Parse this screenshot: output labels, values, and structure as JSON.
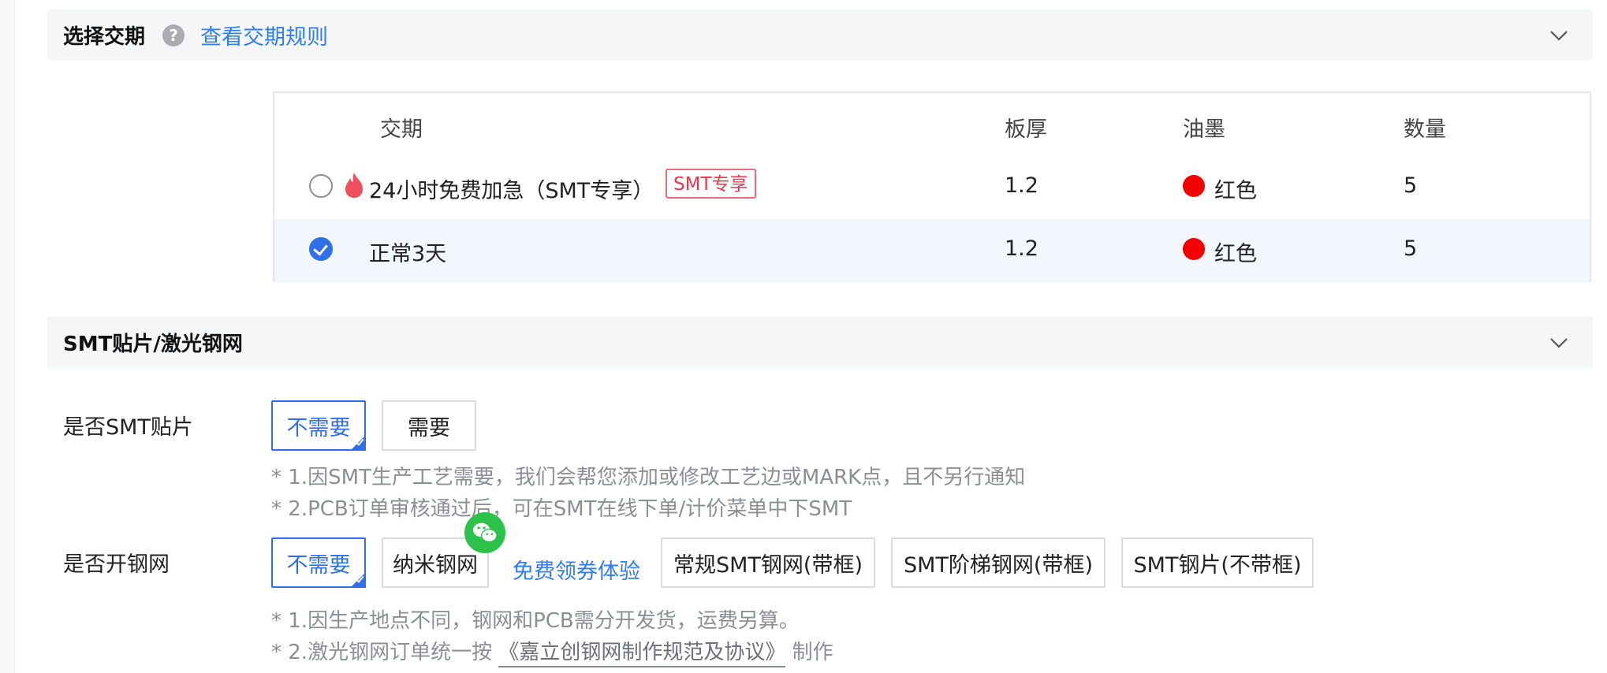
{
  "lead_time_section": {
    "title": "选择交期",
    "help_icon": "question-icon",
    "rules_link": "查看交期规则",
    "table": {
      "headers": [
        "交期",
        "板厚",
        "油墨",
        "数量"
      ],
      "rows": [
        {
          "label": "24小时免费加急（SMT专享）",
          "badge": "SMT专享",
          "thickness": "1.2",
          "ink_color": "#f50000",
          "ink": "红色",
          "quantity": "5",
          "checked": false,
          "icon": "flame-icon"
        },
        {
          "label": "正常3天",
          "thickness": "1.2",
          "ink_color": "#f50000",
          "ink": "红色",
          "quantity": "5",
          "checked": true
        }
      ]
    }
  },
  "smt_section": {
    "title": "SMT贴片/激光钢网",
    "smt_assembly": {
      "label": "是否SMT贴片",
      "options": [
        "不需要",
        "需要"
      ],
      "selected": "不需要",
      "notes": [
        "* 1.因SMT生产工艺需要，我们会帮您添加或修改工艺边或MARK点，且不另行通知",
        "* 2.PCB订单审核通过后，可在SMT在线下单/计价菜单中下SMT"
      ]
    },
    "stencil": {
      "label": "是否开钢网",
      "options": [
        "不需要",
        "纳米钢网",
        "常规SMT钢网(带框)",
        "SMT阶梯钢网(带框)",
        "SMT钢片(不带框)"
      ],
      "selected": "不需要",
      "promo_link": "免费领券体验",
      "promo_icon": "wechat-icon",
      "note1": "* 1.因生产地点不同，钢网和PCB需分开发货，运费另算。",
      "note2_prefix": "* 2.激光钢网订单统一按",
      "note2_link": "《嘉立创钢网制作规范及协议》",
      "note2_suffix": "制作"
    }
  },
  "colors": {
    "accent": "#2f6fe8",
    "link": "#2e7ef0",
    "badge": "#e8374f",
    "wechat": "#2cc24a"
  }
}
